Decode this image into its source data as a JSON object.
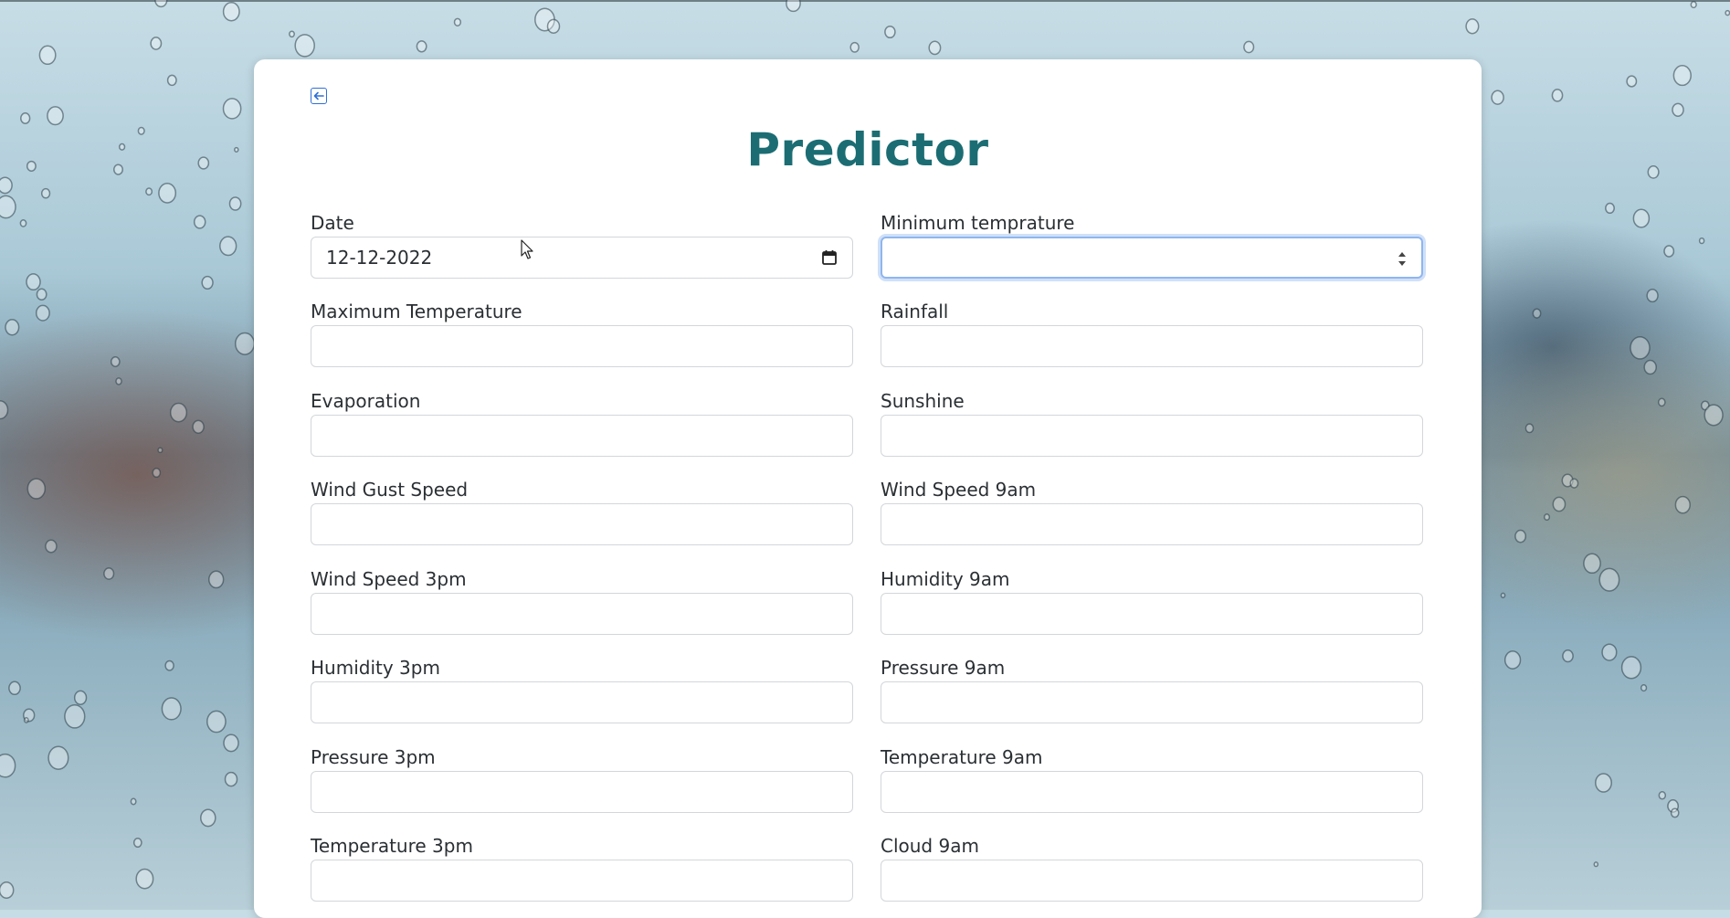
{
  "page": {
    "title": "Predictor"
  },
  "nav": {
    "back_icon": "back-arrow-icon"
  },
  "form": {
    "fields": [
      {
        "label": "Date",
        "value": "12-12-2022",
        "type": "date"
      },
      {
        "label": "Minimum temprature",
        "value": "",
        "type": "number",
        "focused": true
      },
      {
        "label": "Maximum Temperature",
        "value": ""
      },
      {
        "label": "Rainfall",
        "value": ""
      },
      {
        "label": "Evaporation",
        "value": ""
      },
      {
        "label": "Sunshine",
        "value": ""
      },
      {
        "label": "Wind Gust Speed",
        "value": ""
      },
      {
        "label": "Wind Speed 9am",
        "value": ""
      },
      {
        "label": "Wind Speed 3pm",
        "value": ""
      },
      {
        "label": "Humidity 9am",
        "value": ""
      },
      {
        "label": "Humidity 3pm",
        "value": ""
      },
      {
        "label": "Pressure 9am",
        "value": ""
      },
      {
        "label": "Pressure 3pm",
        "value": ""
      },
      {
        "label": "Temperature 9am",
        "value": ""
      },
      {
        "label": "Temperature 3pm",
        "value": ""
      },
      {
        "label": "Cloud 9am",
        "value": ""
      }
    ]
  },
  "colors": {
    "title": "#1b6d73",
    "focus_border": "#8fb5ee",
    "back_icon": "#2f6fd6"
  }
}
